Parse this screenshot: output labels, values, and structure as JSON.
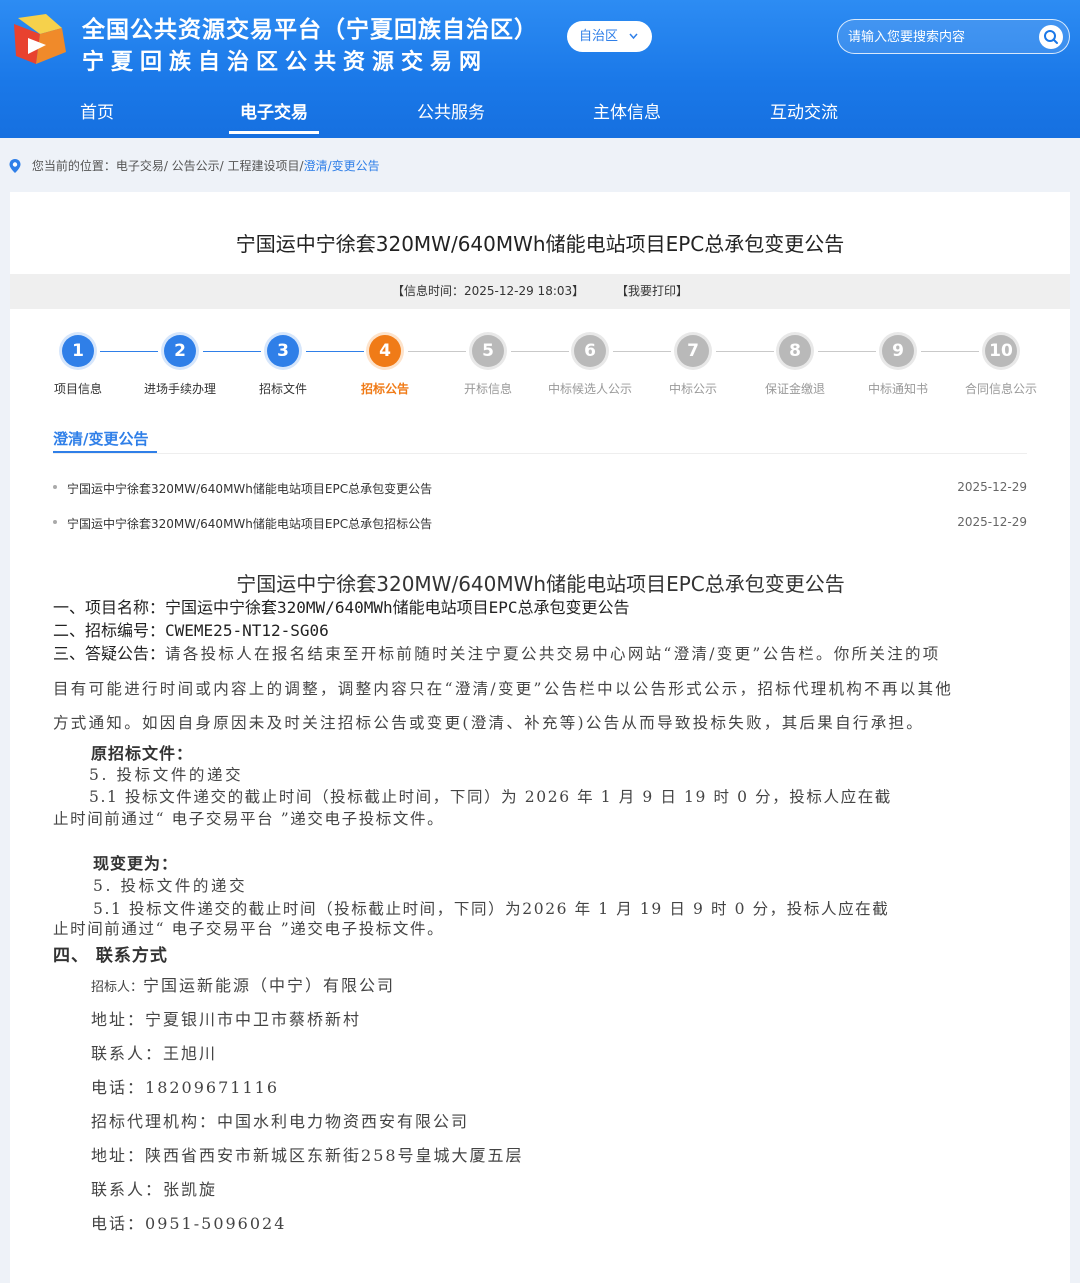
{
  "header": {
    "title_line1": "全国公共资源交易平台（宁夏回族自治区）",
    "title_line2": "宁夏回族自治区公共资源交易网",
    "region_select": "自治区",
    "search_placeholder": "请输入您要搜索内容"
  },
  "nav": [
    {
      "label": "首页"
    },
    {
      "label": "电子交易"
    },
    {
      "label": "公共服务"
    },
    {
      "label": "主体信息"
    },
    {
      "label": "互动交流"
    }
  ],
  "breadcrumb": {
    "prefix": "您当前的位置：电子交易/ 公告公示/ 工程建设项目/",
    "current": "澄清/变更公告"
  },
  "panel": {
    "title": "宁国运中宁徐套320MW/640MWh储能电站项目EPC总承包变更公告",
    "info_time": "【信息时间：2025-12-29 18:03】",
    "print": "【我要打印】"
  },
  "steps": [
    {
      "num": "1",
      "label": "项目信息",
      "state": "done"
    },
    {
      "num": "2",
      "label": "进场手续办理",
      "state": "done"
    },
    {
      "num": "3",
      "label": "招标文件",
      "state": "done"
    },
    {
      "num": "4",
      "label": "招标公告",
      "state": "current"
    },
    {
      "num": "5",
      "label": "开标信息",
      "state": "todo"
    },
    {
      "num": "6",
      "label": "中标候选人公示",
      "state": "todo"
    },
    {
      "num": "7",
      "label": "中标公示",
      "state": "todo"
    },
    {
      "num": "8",
      "label": "保证金缴退",
      "state": "todo"
    },
    {
      "num": "9",
      "label": "中标通知书",
      "state": "todo"
    },
    {
      "num": "10",
      "label": "合同信息公示",
      "state": "todo"
    }
  ],
  "section_tab": "澄清/变更公告",
  "announcements": [
    {
      "title": "宁国运中宁徐套320MW/640MWh储能电站项目EPC总承包变更公告",
      "date": "2025-12-29"
    },
    {
      "title": "宁国运中宁徐套320MW/640MWh储能电站项目EPC总承包招标公告",
      "date": "2025-12-29"
    }
  ],
  "doc": {
    "title": "宁国运中宁徐套320MW/640MWh储能电站项目EPC总承包变更公告",
    "item1_label": "一、项目名称：",
    "item1_value": "宁国运中宁徐套320MW/640MWh储能电站项目EPC总承包变更公告",
    "item2_label": "二、招标编号：",
    "item2_value": "CWEME25-NT12-SG06",
    "item3_label": "三、答疑公告：",
    "item3_line1": "请各投标人在报名结束至开标前随时关注宁夏公共交易中心网站“澄清/变更”公告栏。你所关注的项",
    "item3_line2": "目有可能进行时间或内容上的调整，调整内容只在“澄清/变更”公告栏中以公告形式公示，招标代理机构不再以其他",
    "item3_line3": "方式通知。如因自身原因未及时关注招标公告或变更(澄清、补充等)公告从而导致投标失败，其后果自行承担。",
    "original_heading": "原招标文件：",
    "original_5": "5. 投标文件的递交",
    "original_51_line1": "5.1 投标文件递交的截止时间（投标截止时间，下同）为 2026 年  1  月 9  日  19   时 0 分，投标人应在截",
    "original_51_line2": "止时间前通过“ 电子交易平台 ”递交电子投标文件。",
    "changed_heading": "现变更为：",
    "changed_5": "5. 投标文件的递交",
    "changed_51_line1": "5.1 投标文件递交的截止时间（投标截止时间，下同）为2026 年  1  月 19  日  9   时 0 分，投标人应在截",
    "changed_51_line2": "止时间前通过“ 电子交易平台 ”递交电子投标文件。",
    "item4": "四、 联系方式",
    "contacts": [
      {
        "label": "招标人：",
        "value": "宁国运新能源（中宁）有限公司"
      },
      {
        "label": "地址：",
        "value": "宁夏银川市中卫市蔡桥新村"
      },
      {
        "label": "联系人：",
        "value": "王旭川"
      },
      {
        "label": "电话：",
        "value": "18209671116"
      },
      {
        "label": "招标代理机构：",
        "value": "中国水利电力物资西安有限公司"
      },
      {
        "label": "地址：",
        "value": "陕西省西安市新城区东新街258号皇城大厦五层"
      },
      {
        "label": "联系人：",
        "value": "张凯旋"
      },
      {
        "label": "电话：",
        "value": "0951-5096024"
      }
    ]
  },
  "colors": {
    "header_blue": "#1a78e8",
    "accent_blue": "#2f7fe8",
    "current_orange": "#f07b17",
    "todo_gray": "#b9b9b9"
  },
  "icons": {
    "logo": "platform-logo",
    "search": "search-icon",
    "location": "location-pin-icon",
    "dropdown": "chevron-down-icon"
  }
}
